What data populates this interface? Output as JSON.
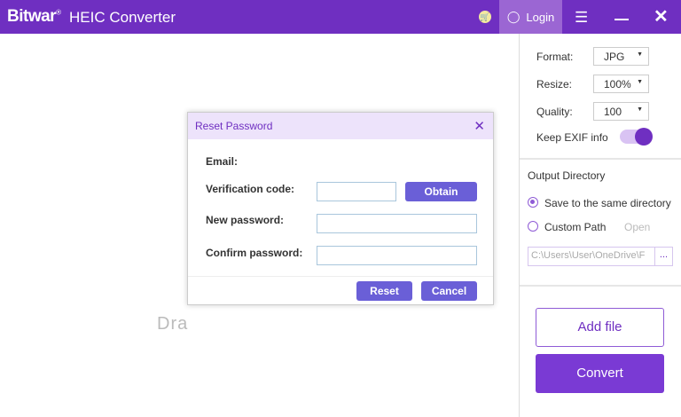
{
  "titlebar": {
    "logo": "Bitwar",
    "title": "HEIC Converter",
    "login": "Login"
  },
  "drop": {
    "text": "Dra"
  },
  "settings": {
    "format_label": "Format:",
    "format_value": "JPG",
    "resize_label": "Resize:",
    "resize_value": "100%",
    "quality_label": "Quality:",
    "quality_value": "100",
    "exif_label": "Keep EXIF info",
    "exif_on": true
  },
  "output": {
    "title": "Output Directory",
    "same_dir": "Save to the same directory",
    "custom_path": "Custom Path",
    "open": "Open",
    "path": "C:\\Users\\User\\OneDrive\\F",
    "browse": "..."
  },
  "actions": {
    "add_file": "Add file",
    "convert": "Convert"
  },
  "dialog": {
    "title": "Reset Password",
    "email_label": "Email:",
    "code_label": "Verification code:",
    "obtain": "Obtain",
    "new_label": "New password:",
    "confirm_label": "Confirm password:",
    "reset": "Reset",
    "cancel": "Cancel"
  },
  "colors": {
    "brand": "#6f2fc1",
    "button": "#6a5fd7"
  }
}
